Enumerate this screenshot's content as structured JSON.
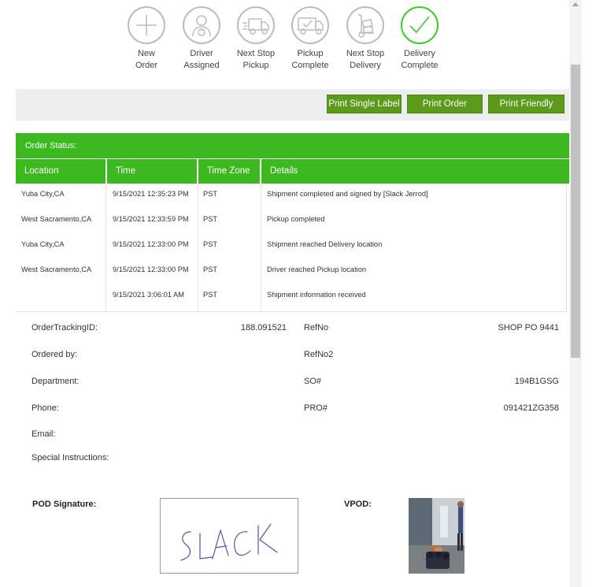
{
  "steps": [
    {
      "label": "New\nOrder",
      "icon": "plus-icon",
      "done": false
    },
    {
      "label": "Driver\nAssigned",
      "icon": "driver-icon",
      "done": false
    },
    {
      "label": "Next Stop\nPickup",
      "icon": "moving-truck-icon",
      "done": false
    },
    {
      "label": "Pickup\nComplete",
      "icon": "truck-check-icon",
      "done": false
    },
    {
      "label": "Next Stop\nDelivery",
      "icon": "hand-truck-icon",
      "done": false
    },
    {
      "label": "Delivery\nComplete",
      "icon": "checkmark-icon",
      "done": true
    }
  ],
  "toolbar": {
    "print_single_label": "Print Single Label",
    "print_order": "Print Order",
    "print_friendly": "Print Friendly"
  },
  "status": {
    "title": "Order Status:",
    "columns": [
      "Location",
      "Time",
      "Time Zone",
      "Details"
    ],
    "rows": [
      {
        "location": "Yuba City,CA",
        "time": "9/15/2021 12:35:23 PM",
        "tz": "PST",
        "details": "Shipment completed and signed by [Slack Jerrod]"
      },
      {
        "location": "West Sacramento,CA",
        "time": "9/15/2021 12:33:59 PM",
        "tz": "PST",
        "details": "Pickup completed"
      },
      {
        "location": "Yuba City,CA",
        "time": "9/15/2021 12:33:00 PM",
        "tz": "PST",
        "details": "Shipment reached Delivery location"
      },
      {
        "location": "West Sacramento,CA",
        "time": "9/15/2021 12:33:00 PM",
        "tz": "PST",
        "details": "Driver reached Pickup location"
      },
      {
        "location": "",
        "time": "9/15/2021 3:06:01 AM",
        "tz": "PST",
        "details": "Shipment information received"
      }
    ]
  },
  "details": {
    "order_tracking_id_label": "OrderTrackingID:",
    "order_tracking_id": "188.091521",
    "ordered_by_label": "Ordered by:",
    "department_label": "Department:",
    "phone_label": "Phone:",
    "email_label": "Email:",
    "special_instructions_label": "Special Instructions:",
    "refno_label": "RefNo",
    "refno": "SHOP PO 9441",
    "refno2_label": "RefNo2",
    "so_label": "SO#",
    "so": "194B1GSG",
    "pro_label": "PRO#",
    "pro": "091421ZG358"
  },
  "pod": {
    "signature_label": "POD Signature:",
    "signature_text": "SLACK",
    "vpod_label": "VPOD:"
  },
  "colors": {
    "green_header": "#3cb91f",
    "button_green": "#5b9a1b",
    "done_circle": "#3fcb2a"
  }
}
